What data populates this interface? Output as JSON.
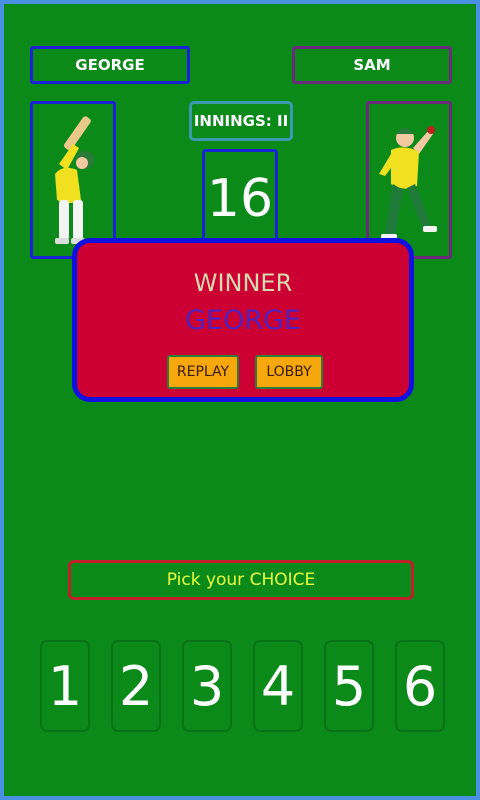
{
  "players": {
    "left_name": "GEORGE",
    "right_name": "SAM"
  },
  "innings_label": "INNINGS: II",
  "score": "16",
  "result": {
    "title": "WINNER",
    "winner": "GEORGE",
    "replay_label": "REPLAY",
    "lobby_label": "LOBBY"
  },
  "choice_prompt": "Pick your CHOICE",
  "choices": [
    "1",
    "2",
    "3",
    "4",
    "5",
    "6"
  ],
  "colors": {
    "field": "#0b8a1a",
    "panel": "#cc0033",
    "button": "#f5a70c"
  }
}
